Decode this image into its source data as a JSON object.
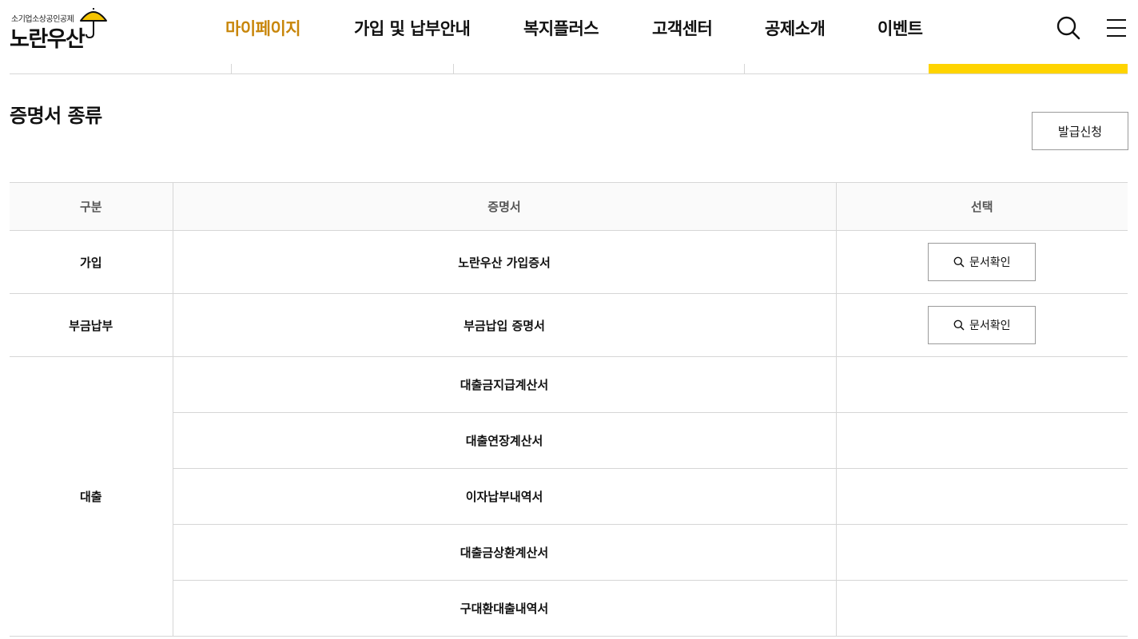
{
  "logo": {
    "subtitle": "소기업소상공인공제",
    "name": "노란우산"
  },
  "nav": {
    "items": [
      {
        "label": "마이페이지",
        "active": true
      },
      {
        "label": "가입 및 납부안내",
        "active": false
      },
      {
        "label": "복지플러스",
        "active": false
      },
      {
        "label": "고객센터",
        "active": false
      },
      {
        "label": "공제소개",
        "active": false
      },
      {
        "label": "이벤트",
        "active": false
      }
    ],
    "icons": [
      "search-icon",
      "hamburger-menu-icon"
    ]
  },
  "colors": {
    "accent": "#ffd400",
    "nav_active": "#c8860a",
    "umbrella": "#f5c400"
  },
  "section": {
    "title": "증명서 종류",
    "issue_button": "발급신청"
  },
  "table": {
    "headers": [
      "구분",
      "증명서",
      "선택"
    ],
    "groups": [
      {
        "category": "가입",
        "rows": [
          {
            "certificate": "노란우산 가입증서",
            "action": "문서확인"
          }
        ]
      },
      {
        "category": "부금납부",
        "rows": [
          {
            "certificate": "부금납입 증명서",
            "action": "문서확인"
          }
        ]
      },
      {
        "category": "대출",
        "rows": [
          {
            "certificate": "대출금지급계산서",
            "action": ""
          },
          {
            "certificate": "대출연장계산서",
            "action": ""
          },
          {
            "certificate": "이자납부내역서",
            "action": ""
          },
          {
            "certificate": "대출금상환계산서",
            "action": ""
          },
          {
            "certificate": "구대환대출내역서",
            "action": ""
          }
        ]
      }
    ]
  }
}
